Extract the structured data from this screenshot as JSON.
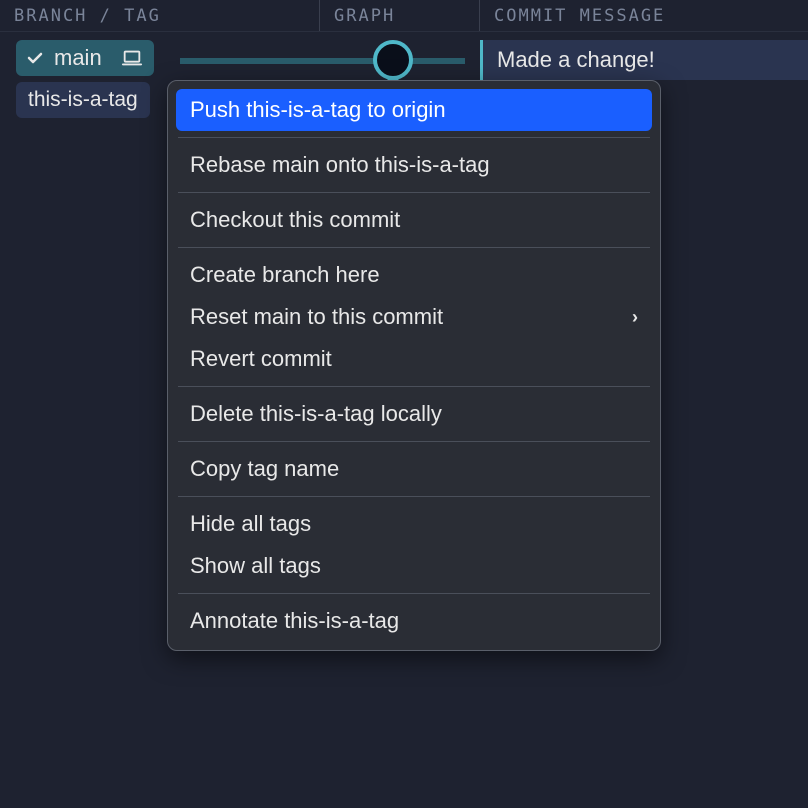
{
  "header": {
    "branch_tag": "BRANCH / TAG",
    "graph": "GRAPH",
    "commit_message": "COMMIT MESSAGE"
  },
  "branch": {
    "name": "main"
  },
  "tag": {
    "name": "this-is-a-tag"
  },
  "commit": {
    "message": "Made a change!"
  },
  "context_menu": {
    "items": [
      {
        "label": "Push this-is-a-tag to origin",
        "highlighted": true
      },
      {
        "separator": true
      },
      {
        "label": "Rebase main onto this-is-a-tag"
      },
      {
        "separator": true
      },
      {
        "label": "Checkout this commit"
      },
      {
        "separator": true
      },
      {
        "label": "Create branch here"
      },
      {
        "label": "Reset main to this commit",
        "submenu": true
      },
      {
        "label": "Revert commit"
      },
      {
        "separator": true
      },
      {
        "label": "Delete this-is-a-tag locally"
      },
      {
        "separator": true
      },
      {
        "label": "Copy tag name"
      },
      {
        "separator": true
      },
      {
        "label": "Hide all tags"
      },
      {
        "label": "Show all tags"
      },
      {
        "separator": true
      },
      {
        "label": "Annotate this-is-a-tag"
      }
    ]
  }
}
